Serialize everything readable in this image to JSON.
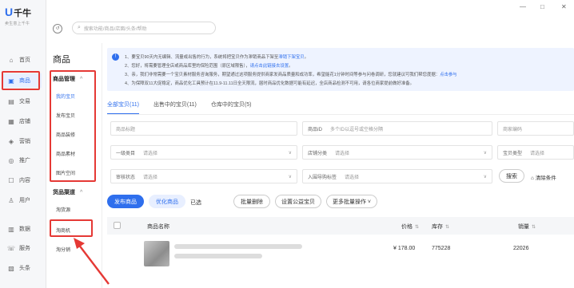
{
  "rail": {
    "logo_mark": "U",
    "logo_text": "千牛",
    "logo_sub": "卖生意上千牛",
    "items": [
      {
        "icon": "⌂",
        "label": "首页"
      },
      {
        "icon": "▣",
        "label": "商品"
      },
      {
        "icon": "▤",
        "label": "交易"
      },
      {
        "icon": "▦",
        "label": "店铺"
      },
      {
        "icon": "◈",
        "label": "营销"
      },
      {
        "icon": "◎",
        "label": "推广"
      },
      {
        "icon": "☐",
        "label": "内容"
      },
      {
        "icon": "♙",
        "label": "用户"
      },
      {
        "icon": "▥",
        "label": "数据"
      },
      {
        "icon": "☏",
        "label": "服务"
      },
      {
        "icon": "▧",
        "label": "头条"
      }
    ]
  },
  "topbar": {
    "search_placeholder": "搜索功能/商品/店面/头条/帮助",
    "win_min": "—",
    "win_max": "□",
    "win_close": "✕"
  },
  "subnav": {
    "title": "商品",
    "group1": "商品管理",
    "group1_items": [
      "我的宝贝",
      "发布宝贝",
      "商品装修",
      "商品素材",
      "图片空间"
    ],
    "group2": "货品渠道",
    "group2_items": [
      "淘货源",
      "淘商机",
      "淘分销"
    ],
    "chevron": "^"
  },
  "notice": {
    "icon": "!",
    "line1_a": "1、要宝贝90天内无编辑、流量或出售的行为，系统将把宝贝作为滞销商品下架至",
    "line1_link": "滞销下架宝贝",
    "line1_b": "。",
    "line2_a": "2、您好，将需要管理全店或商品库里的保险范围（原区域限售），",
    "line2_link": "请点击此链接去设置",
    "line2_b": "。",
    "line3_a": "3、亲，我们非常需要一个宝贝素材服务咨询服务，期望通过这项服务提供商家发商品质量和成功率，希望能花1分钟时间等参与问卷调研，您就建议可我们帮您度据：",
    "line3_link": "点击参与",
    "line4": "4、为保障双11大促稳定，商品优化工具预计在11.9-11.11日全天限流，届时商品优化数据可能有延迟，全店商品检测不可用，请各位商家提前做好准备。"
  },
  "tabs": [
    {
      "label": "全部宝贝(11)",
      "active": true
    },
    {
      "label": "出售中的宝贝(11)",
      "active": false
    },
    {
      "label": "仓库中的宝贝(5)",
      "active": false
    }
  ],
  "filters": {
    "title_ph": "商品标题",
    "id_label": "商品ID",
    "id_ph": "多个ID以逗号或空格分隔",
    "code_ph": "商家编码",
    "cat_label": "一级类目",
    "cat_ph": "请选择",
    "shopcat_label": "店铺分类",
    "shopcat_ph": "请选择",
    "type_label": "宝贝类型",
    "type_ph": "请选择",
    "audit_label": "审核状态",
    "audit_ph": "请选择",
    "import_label": "入围导购标签",
    "import_ph": "请选择",
    "arrow": "∨",
    "search_btn": "搜索",
    "clear": "清除条件",
    "clear_icon": "⌂"
  },
  "actions": {
    "publish": "发布商品",
    "optimize": "优化商品",
    "selected": "已选",
    "bulk_delete": "批量删除",
    "set_public": "设置公益宝贝",
    "more": "更多批量操作 ˅"
  },
  "table": {
    "col_name": "商品名称",
    "col_price": "价格",
    "col_stock": "库存",
    "col_sales": "销量",
    "sort": "⇅",
    "rows": [
      {
        "price": "¥ 178.00",
        "stock": "775228",
        "sales": "22026"
      }
    ]
  },
  "colors": {
    "accent": "#2f6fed",
    "highlight": "#e53935"
  }
}
